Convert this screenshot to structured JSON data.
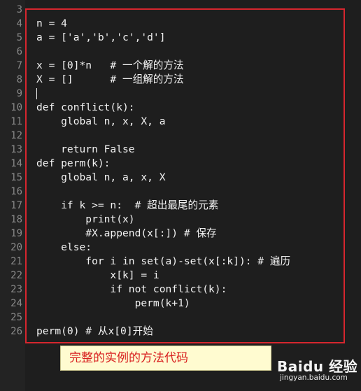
{
  "editor": {
    "lines": [
      {
        "num": "3",
        "text": ""
      },
      {
        "num": "4",
        "text": "n = 4"
      },
      {
        "num": "5",
        "text": "a = ['a','b','c','d']"
      },
      {
        "num": "6",
        "text": ""
      },
      {
        "num": "7",
        "text": "x = [0]*n   # 一个解的方法"
      },
      {
        "num": "8",
        "text": "X = []      # 一组解的方法"
      },
      {
        "num": "9",
        "text": ""
      },
      {
        "num": "10",
        "text": "def conflict(k):"
      },
      {
        "num": "11",
        "text": "    global n, x, X, a"
      },
      {
        "num": "12",
        "text": ""
      },
      {
        "num": "13",
        "text": "    return False"
      },
      {
        "num": "14",
        "text": "def perm(k):"
      },
      {
        "num": "15",
        "text": "    global n, a, x, X"
      },
      {
        "num": "16",
        "text": ""
      },
      {
        "num": "17",
        "text": "    if k >= n:  # 超出最尾的元素"
      },
      {
        "num": "18",
        "text": "        print(x)"
      },
      {
        "num": "19",
        "text": "        #X.append(x[:]) # 保存"
      },
      {
        "num": "20",
        "text": "    else:"
      },
      {
        "num": "21",
        "text": "        for i in set(a)-set(x[:k]): # 遍历"
      },
      {
        "num": "22",
        "text": "            x[k] = i"
      },
      {
        "num": "23",
        "text": "            if not conflict(k):"
      },
      {
        "num": "24",
        "text": "                perm(k+1)"
      },
      {
        "num": "25",
        "text": ""
      },
      {
        "num": "26",
        "text": "perm(0) # 从x[0]开始"
      }
    ],
    "cursor_line": "9"
  },
  "caption": "完整的实例的方法代码",
  "watermark": {
    "title": "Baidu 经验",
    "url": "jingyan.baidu.com"
  },
  "colors": {
    "background": "#1e1e1e",
    "text": "#f2f2f2",
    "line_numbers": "#8a8a8a",
    "highlight_frame": "#d6262e",
    "caption_bg": "#fffbd0",
    "caption_text": "#d81e1e"
  }
}
